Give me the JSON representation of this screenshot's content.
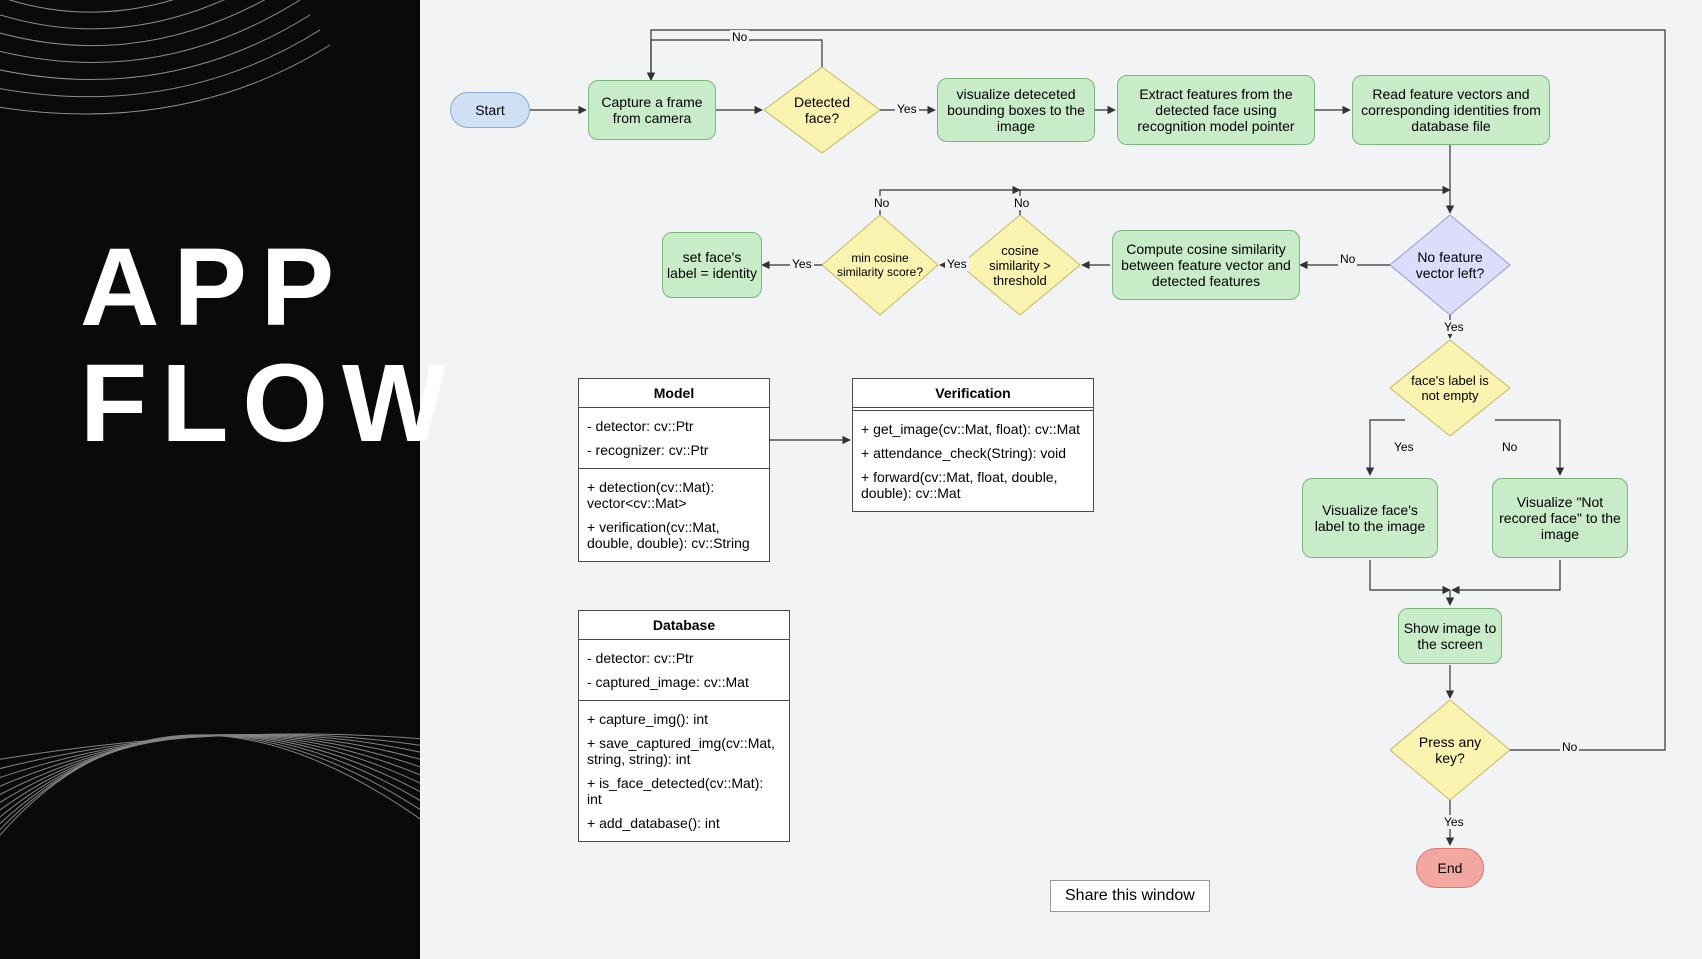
{
  "title_line1": "APP",
  "title_line2": "FLOW",
  "share": "Share this window",
  "nodes": {
    "start": "Start",
    "capture": "Capture a frame from camera",
    "detected": "Detected face?",
    "visualize_boxes": "visualize deteceted bounding boxes to the image",
    "extract": "Extract features from the detected face using recognition model pointer",
    "read": "Read feature vectors and corresponding identities from database file",
    "no_vector": "No feature vector left?",
    "compute": "Compute cosine similarity between feature vector and detected features",
    "threshold": "cosine similarity > threshold",
    "min_score": "min cosine similarity score?",
    "set_label": "set face's label = identity",
    "label_not_empty": "face's label is not empty",
    "vis_label": "Visualize face's label to the image",
    "vis_not_recorded": "Visualize \"Not recored face\" to the image",
    "show": "Show image to the screen",
    "press_key": "Press any key?",
    "end": "End"
  },
  "labels": {
    "yes": "Yes",
    "no": "No"
  },
  "uml": {
    "model": {
      "name": "Model",
      "attrs": [
        "- detector: cv::Ptr",
        "- recognizer: cv::Ptr"
      ],
      "ops": [
        "+ detection(cv::Mat): vector<cv::Mat>",
        "+ verification(cv::Mat, double, double): cv::String"
      ]
    },
    "verification": {
      "name": "Verification",
      "attrs": [],
      "ops": [
        "+ get_image(cv::Mat, float): cv::Mat",
        "+ attendance_check(String): void",
        "+ forward(cv::Mat, float, double, double): cv::Mat"
      ]
    },
    "database": {
      "name": "Database",
      "attrs": [
        "- detector: cv::Ptr",
        "- captured_image: cv::Mat"
      ],
      "ops": [
        "+ capture_img(): int",
        "+ save_captured_img(cv::Mat, string, string): int",
        "+ is_face_detected(cv::Mat): int",
        "+ add_database(): int"
      ]
    }
  },
  "chart_data": {
    "type": "flowchart",
    "nodes": [
      {
        "id": "start",
        "kind": "terminator",
        "label": "Start"
      },
      {
        "id": "capture",
        "kind": "process",
        "label": "Capture a frame from camera"
      },
      {
        "id": "detected",
        "kind": "decision",
        "label": "Detected face?"
      },
      {
        "id": "visualize_boxes",
        "kind": "process",
        "label": "visualize deteceted bounding boxes to the image"
      },
      {
        "id": "extract",
        "kind": "process",
        "label": "Extract features from the detected face using recognition model pointer"
      },
      {
        "id": "read",
        "kind": "process",
        "label": "Read feature vectors and corresponding identities from database file"
      },
      {
        "id": "no_vector",
        "kind": "decision",
        "label": "No feature vector left?"
      },
      {
        "id": "compute",
        "kind": "process",
        "label": "Compute cosine similarity between feature vector and detected features"
      },
      {
        "id": "threshold",
        "kind": "decision",
        "label": "cosine similarity > threshold"
      },
      {
        "id": "min_score",
        "kind": "decision",
        "label": "min cosine similarity score?"
      },
      {
        "id": "set_label",
        "kind": "process",
        "label": "set face's label = identity"
      },
      {
        "id": "label_not_empty",
        "kind": "decision",
        "label": "face's label is not empty"
      },
      {
        "id": "vis_label",
        "kind": "process",
        "label": "Visualize face's label to the image"
      },
      {
        "id": "vis_not_recorded",
        "kind": "process",
        "label": "Visualize \"Not recored face\" to the image"
      },
      {
        "id": "show",
        "kind": "process",
        "label": "Show image to the screen"
      },
      {
        "id": "press_key",
        "kind": "decision",
        "label": "Press any key?"
      },
      {
        "id": "end",
        "kind": "terminator",
        "label": "End"
      }
    ],
    "edges": [
      {
        "from": "start",
        "to": "capture"
      },
      {
        "from": "capture",
        "to": "detected"
      },
      {
        "from": "detected",
        "to": "visualize_boxes",
        "label": "Yes"
      },
      {
        "from": "detected",
        "to": "capture",
        "label": "No"
      },
      {
        "from": "visualize_boxes",
        "to": "extract"
      },
      {
        "from": "extract",
        "to": "read"
      },
      {
        "from": "read",
        "to": "no_vector"
      },
      {
        "from": "no_vector",
        "to": "compute",
        "label": "No"
      },
      {
        "from": "compute",
        "to": "threshold"
      },
      {
        "from": "threshold",
        "to": "min_score",
        "label": "Yes"
      },
      {
        "from": "threshold",
        "to": "no_vector",
        "label": "No",
        "note": "back to read/no-vector loop"
      },
      {
        "from": "min_score",
        "to": "set_label",
        "label": "Yes"
      },
      {
        "from": "min_score",
        "to": "no_vector",
        "label": "No",
        "note": "loop back"
      },
      {
        "from": "no_vector",
        "to": "label_not_empty",
        "label": "Yes"
      },
      {
        "from": "label_not_empty",
        "to": "vis_label",
        "label": "Yes"
      },
      {
        "from": "label_not_empty",
        "to": "vis_not_recorded",
        "label": "No"
      },
      {
        "from": "vis_label",
        "to": "show"
      },
      {
        "from": "vis_not_recorded",
        "to": "show"
      },
      {
        "from": "show",
        "to": "press_key"
      },
      {
        "from": "press_key",
        "to": "end",
        "label": "Yes"
      },
      {
        "from": "press_key",
        "to": "capture",
        "label": "No",
        "note": "loop to top"
      }
    ],
    "classes": [
      {
        "name": "Model",
        "attributes": [
          "- detector: cv::Ptr",
          "- recognizer: cv::Ptr"
        ],
        "operations": [
          "+ detection(cv::Mat): vector<cv::Mat>",
          "+ verification(cv::Mat, double, double): cv::String"
        ]
      },
      {
        "name": "Verification",
        "attributes": [],
        "operations": [
          "+ get_image(cv::Mat, float): cv::Mat",
          "+ attendance_check(String): void",
          "+ forward(cv::Mat, float, double, double): cv::Mat"
        ]
      },
      {
        "name": "Database",
        "attributes": [
          "- detector: cv::Ptr",
          "- captured_image: cv::Mat"
        ],
        "operations": [
          "+ capture_img(): int",
          "+ save_captured_img(cv::Mat, string, string): int",
          "+ is_face_detected(cv::Mat): int",
          "+ add_database(): int"
        ]
      }
    ],
    "class_links": [
      {
        "from": "Model",
        "to": "Verification"
      }
    ]
  }
}
